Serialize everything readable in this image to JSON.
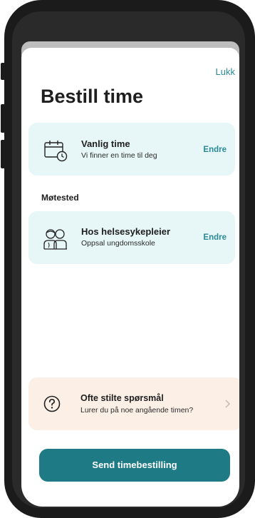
{
  "header": {
    "close_label": "Lukk",
    "title": "Bestill time"
  },
  "appointment_type": {
    "title": "Vanlig time",
    "subtitle": "Vi finner en time til deg",
    "edit_label": "Endre",
    "icon": "calendar-clock-icon"
  },
  "meeting_place": {
    "section_label": "Møtested",
    "title": "Hos helsesykepleier",
    "subtitle": "Oppsal ungdomsskole",
    "edit_label": "Endre",
    "icon": "nurse-people-icon"
  },
  "faq": {
    "title": "Ofte stilte spørsmål",
    "subtitle": "Lurer du på noe angående timen?",
    "icon": "question-circle-icon",
    "chevron": "chevron-right-icon"
  },
  "submit": {
    "label": "Send timebestilling"
  },
  "colors": {
    "accent": "#1e7b86",
    "link": "#2a8a96",
    "card_bg": "#e7f6f6",
    "faq_bg": "#fcefe6"
  }
}
